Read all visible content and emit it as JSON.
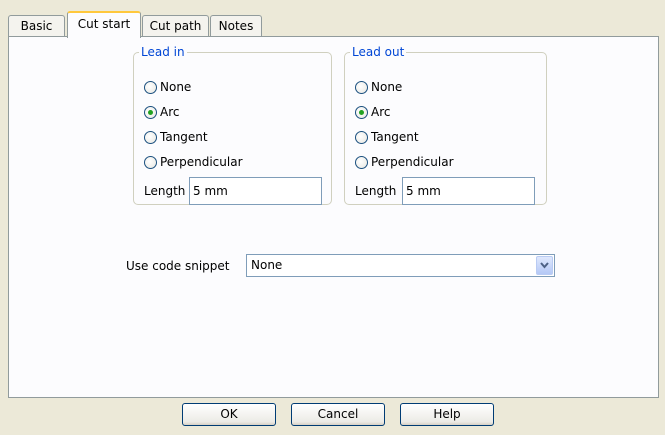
{
  "tabs": [
    {
      "label": "Basic"
    },
    {
      "label": "Cut start"
    },
    {
      "label": "Cut path"
    },
    {
      "label": "Notes"
    }
  ],
  "active_tab": "Cut start",
  "lead_in": {
    "title": "Lead in",
    "options": [
      "None",
      "Arc",
      "Tangent",
      "Perpendicular"
    ],
    "selected": "Arc",
    "length_label": "Length",
    "length_value": "5 mm"
  },
  "lead_out": {
    "title": "Lead out",
    "options": [
      "None",
      "Arc",
      "Tangent",
      "Perpendicular"
    ],
    "selected": "Arc",
    "length_label": "Length",
    "length_value": "5 mm"
  },
  "code_snippet": {
    "label": "Use code snippet",
    "selected": "None"
  },
  "buttons": {
    "ok": "OK",
    "cancel": "Cancel",
    "help": "Help"
  },
  "icons": {
    "radio": "radio-button-icon",
    "dropdown": "chevron-down-icon"
  },
  "colors": {
    "background": "#ece9d8",
    "panel": "#fcfcfe",
    "legend_text": "#0046d5",
    "active_tab_accent": "#ffc83c",
    "radio_dot": "#21a121"
  }
}
